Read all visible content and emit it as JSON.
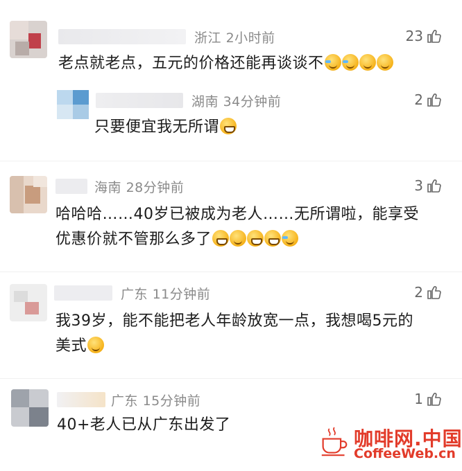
{
  "comments": [
    {
      "location": "浙江",
      "time": "2小时前",
      "likes": "23",
      "text": "老点就老点，五元的价格还能再谈谈不"
    },
    {
      "location": "湖南",
      "time": "34分钟前",
      "likes": "2",
      "text": "只要便宜我无所谓"
    },
    {
      "location": "海南",
      "time": "28分钟前",
      "likes": "3",
      "text_line1": "哈哈哈……40岁已被成为老人……无所谓啦，能享受",
      "text_line2": "优惠价就不管那么多了"
    },
    {
      "location": "广东",
      "time": "11分钟前",
      "likes": "2",
      "text_line1": "我39岁，能不能把老人年龄放宽一点，我想喝5元的",
      "text_line2": "美式"
    },
    {
      "location": "广东",
      "time": "15分钟前",
      "likes": "1",
      "text": "40+老人已从广东出发了"
    }
  ],
  "watermark": {
    "cn": "咖啡网.中国",
    "en": "CoffeeWeb.cn"
  },
  "icons": {
    "like": "thumbs-up-icon",
    "emoji": "emoji-icon",
    "cup": "coffee-cup-icon"
  },
  "colors": {
    "watermark": "#e23b2a",
    "meta": "#8a8a8a"
  }
}
